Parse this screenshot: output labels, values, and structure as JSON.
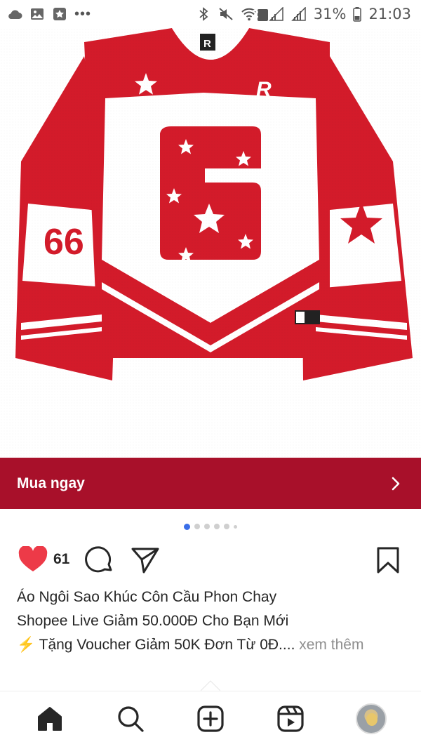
{
  "status_bar": {
    "wifi_badge": "2",
    "battery_percent": "31%",
    "time": "21:03",
    "more": "•••"
  },
  "product": {
    "jersey_number": "6",
    "sleeve_number": "66",
    "colors": {
      "primary_red": "#d31b2a",
      "white": "#ffffff",
      "dark_red": "#a8102a"
    }
  },
  "buy_bar": {
    "label": "Mua ngay"
  },
  "carousel": {
    "total_dots": 6,
    "active_index": 0
  },
  "actions": {
    "like_count": "61"
  },
  "caption": {
    "line1": "Áo Ngôi Sao Khúc Côn Cầu Phon Chay",
    "line2": "Shopee Live Giảm 50.000Đ Cho Bạn Mới",
    "line3_icon": "⚡",
    "line3": "Tặng Voucher Giảm 50K Đơn Từ 0Đ....",
    "more_label": "xem thêm"
  },
  "nav": {
    "items": [
      "home-icon",
      "search-icon",
      "create-icon",
      "reels-icon",
      "profile-avatar"
    ]
  }
}
